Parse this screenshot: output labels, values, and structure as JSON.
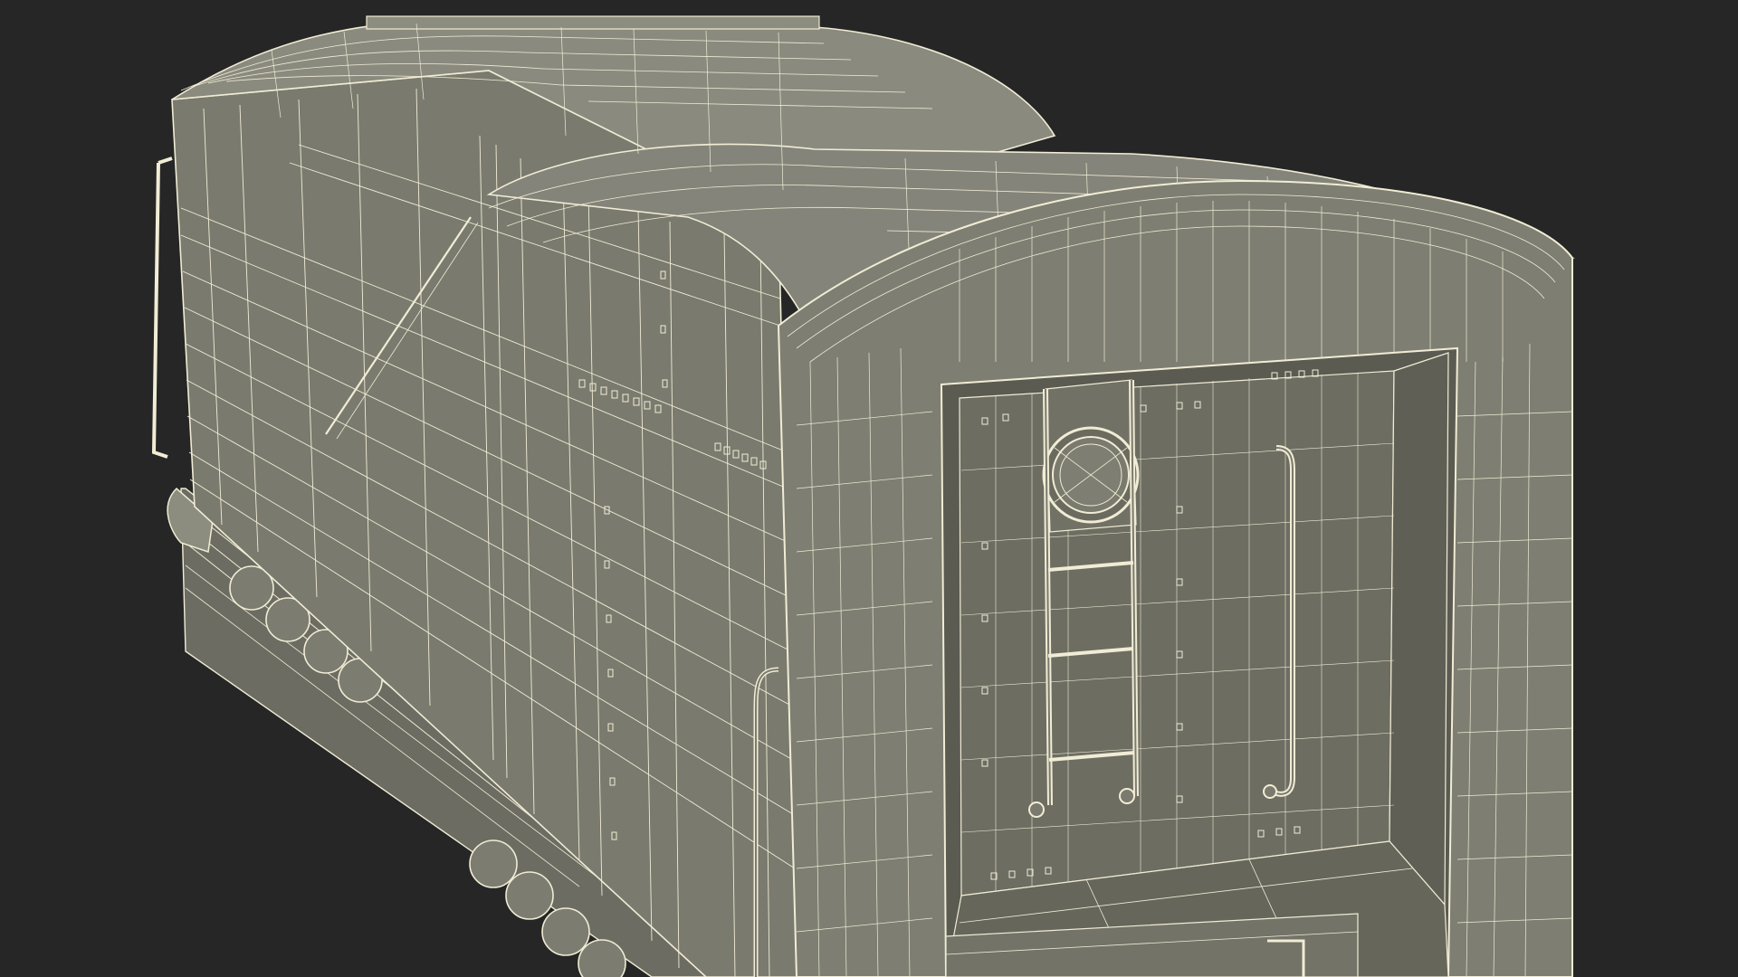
{
  "scene": {
    "subject": "tender-car-wireframe-render",
    "view": "rear-three-quarter",
    "render_mode": "wireframe-on-shaded",
    "colors": {
      "background": "#262626",
      "surface_light": "#8c8c7f",
      "surface_mid": "#7c7c70",
      "surface_dark": "#66665b",
      "recess": "#55554c",
      "wire": "#f1ecd5",
      "wire_dim": "#d8d3bc"
    }
  }
}
